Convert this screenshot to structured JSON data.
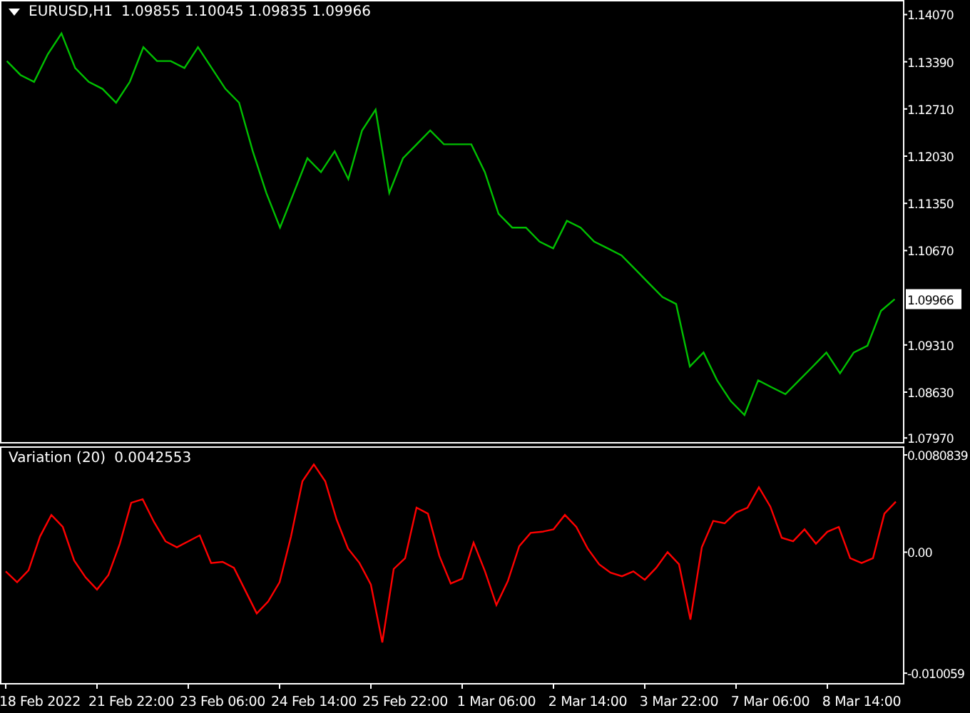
{
  "price_chart": {
    "quote": "1.09855 1.10045 1.09835 1.09966",
    "current_price": "1.09966",
    "chart_data": {
      "type": "line",
      "ylim": [
        1.0789,
        1.1428
      ],
      "yticks": [
        {
          "value": 1.1407,
          "label": "1.14070"
        },
        {
          "value": 1.1339,
          "label": "1.13390"
        },
        {
          "value": 1.1271,
          "label": "1.12710"
        },
        {
          "value": 1.1203,
          "label": "1.12030"
        },
        {
          "value": 1.1135,
          "label": "1.11350"
        },
        {
          "value": 1.1067,
          "label": "1.10670"
        },
        {
          "value": 1.0931,
          "label": "1.09310"
        },
        {
          "value": 1.0863,
          "label": "1.08630"
        },
        {
          "value": 1.0797,
          "label": "1.07970"
        }
      ],
      "categories": [
        null,
        null,
        null,
        null,
        null,
        null,
        null,
        null,
        null,
        null,
        null,
        null,
        null,
        null,
        null,
        null,
        null,
        null,
        null,
        null,
        null,
        null,
        null,
        null,
        null,
        null,
        null,
        null,
        null,
        null,
        null,
        null,
        null,
        null,
        null,
        null,
        null,
        null,
        null,
        null,
        null,
        null,
        null,
        null,
        null,
        null,
        null,
        null,
        null,
        null,
        null,
        null,
        null,
        null,
        null,
        null,
        null,
        null,
        null,
        null,
        null,
        null,
        null,
        null,
        null,
        null
      ],
      "series": [
        {
          "name": "EURUSD,H1",
          "color": "#00c000",
          "values": [
            1.134,
            1.132,
            1.131,
            1.135,
            1.138,
            1.133,
            1.131,
            1.13,
            1.128,
            1.131,
            1.136,
            1.134,
            1.134,
            1.133,
            1.136,
            1.133,
            1.13,
            1.128,
            1.121,
            1.115,
            1.11,
            1.115,
            1.12,
            1.118,
            1.121,
            1.117,
            1.124,
            1.127,
            1.115,
            1.12,
            1.122,
            1.124,
            1.122,
            1.122,
            1.122,
            1.118,
            1.112,
            1.11,
            1.11,
            1.108,
            1.107,
            1.111,
            1.11,
            1.108,
            1.107,
            1.106,
            1.104,
            1.102,
            1.1,
            1.099,
            1.09,
            1.092,
            1.088,
            1.085,
            1.083,
            1.088,
            1.087,
            1.086,
            1.088,
            1.09,
            1.092,
            1.089,
            1.092,
            1.093,
            1.098,
            1.0997
          ]
        }
      ]
    }
  },
  "indicator": {
    "value": "0.0042553",
    "chart_data": {
      "type": "line",
      "ylim": [
        -0.011,
        0.0088
      ],
      "yticks": [
        {
          "value": 0.0080839,
          "label": "0.0080839"
        },
        {
          "value": 0,
          "label": "0.00"
        },
        {
          "value": -0.010059,
          "label": "-0.010059"
        }
      ],
      "categories": [
        null,
        null,
        null,
        "18 Feb 2022",
        null,
        null,
        null,
        null,
        null,
        null,
        null,
        "21 Feb 22:00",
        null,
        null,
        null,
        null,
        null,
        null,
        null,
        "23 Feb 06:00",
        null,
        null,
        null,
        null,
        null,
        null,
        null,
        "24 Feb 14:00",
        null,
        null,
        null,
        null,
        null,
        null,
        null,
        "25 Feb 22:00",
        null,
        null,
        null,
        null,
        null,
        null,
        null,
        "1 Mar 06:00",
        null,
        null,
        null,
        null,
        null,
        null,
        null,
        "2 Mar 14:00",
        null,
        null,
        null,
        null,
        null,
        null,
        null,
        "3 Mar 22:00",
        null,
        null,
        null,
        null,
        null,
        null,
        null,
        "7 Mar 06:00",
        null,
        null,
        null,
        null,
        null,
        null,
        null,
        "8 Mar 14:00",
        null,
        null,
        null
      ],
      "series": [
        {
          "name": "Variation (20)",
          "color": "#ff0000",
          "values": [
            -0.0016,
            -0.0025,
            -0.0015,
            0.0013,
            0.0031,
            0.0021,
            -0.0007,
            -0.0021,
            -0.0031,
            -0.0019,
            0.0007,
            0.0041,
            0.0044,
            0.0025,
            0.0009,
            0.0004,
            0.0009,
            0.0014,
            -0.0009,
            -0.0008,
            -0.0013,
            -0.0032,
            -0.0051,
            -0.0041,
            -0.0025,
            0.0013,
            0.0059,
            0.0073,
            0.0059,
            0.0027,
            0.0003,
            -0.0009,
            -0.0027,
            -0.0075,
            -0.0014,
            -0.0005,
            0.0037,
            0.0032,
            -0.0003,
            -0.0026,
            -0.0022,
            0.0008,
            -0.0016,
            -0.0044,
            -0.0024,
            0.0005,
            0.0016,
            0.0017,
            0.0019,
            0.0031,
            0.0021,
            0.0003,
            -0.001,
            -0.0017,
            -0.002,
            -0.0016,
            -0.0023,
            -0.0013,
            0,
            -0.001,
            -0.0056,
            0.0004,
            0.0026,
            0.0024,
            0.0033,
            0.0037,
            0.0054,
            0.0038,
            0.0012,
            0.0009,
            0.0019,
            0.0007,
            0.0017,
            0.0021,
            -0.0005,
            -0.0009,
            -0.0005,
            0.0032,
            0.0042
          ]
        }
      ]
    }
  }
}
